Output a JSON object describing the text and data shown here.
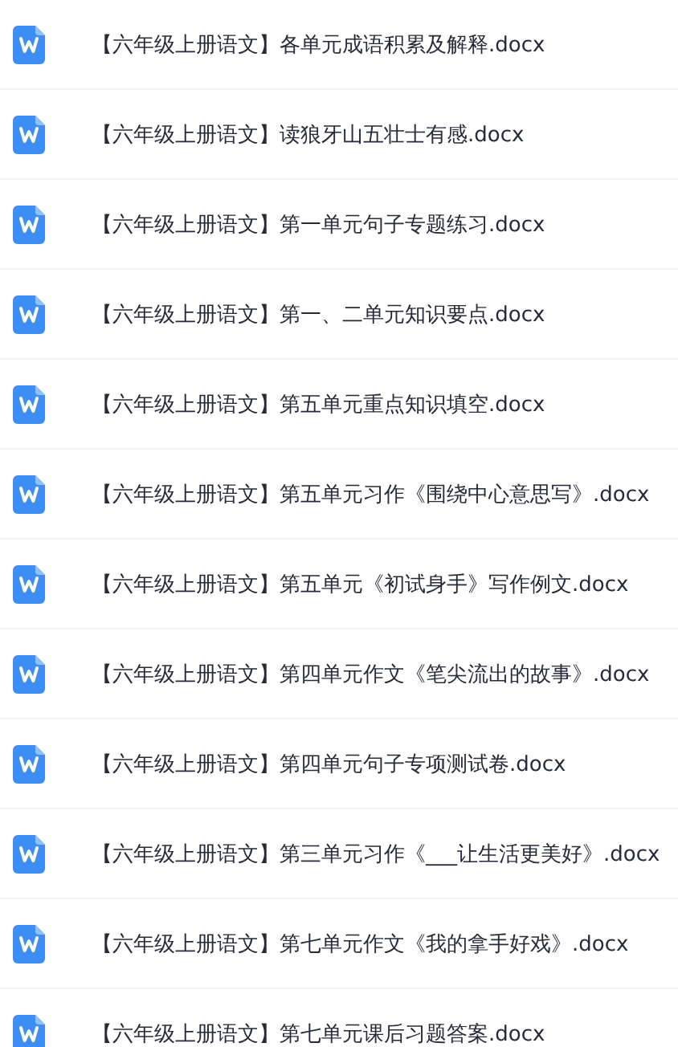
{
  "files": [
    {
      "name": "【六年级上册语文】各单元成语积累及解释.docx"
    },
    {
      "name": "【六年级上册语文】读狼牙山五壮士有感.docx"
    },
    {
      "name": "【六年级上册语文】第一单元句子专题练习.docx"
    },
    {
      "name": "【六年级上册语文】第一、二单元知识要点.docx"
    },
    {
      "name": "【六年级上册语文】第五单元重点知识填空.docx"
    },
    {
      "name": "【六年级上册语文】第五单元习作《围绕中心意思写》.docx"
    },
    {
      "name": "【六年级上册语文】第五单元《初试身手》写作例文.docx"
    },
    {
      "name": "【六年级上册语文】第四单元作文《笔尖流出的故事》.docx"
    },
    {
      "name": "【六年级上册语文】第四单元句子专项测试卷.docx"
    },
    {
      "name": "【六年级上册语文】第三单元习作《___让生活更美好》.docx"
    },
    {
      "name": "【六年级上册语文】第七单元作文《我的拿手好戏》.docx"
    },
    {
      "name": "【六年级上册语文】第七单元课后习题答案.docx"
    }
  ]
}
